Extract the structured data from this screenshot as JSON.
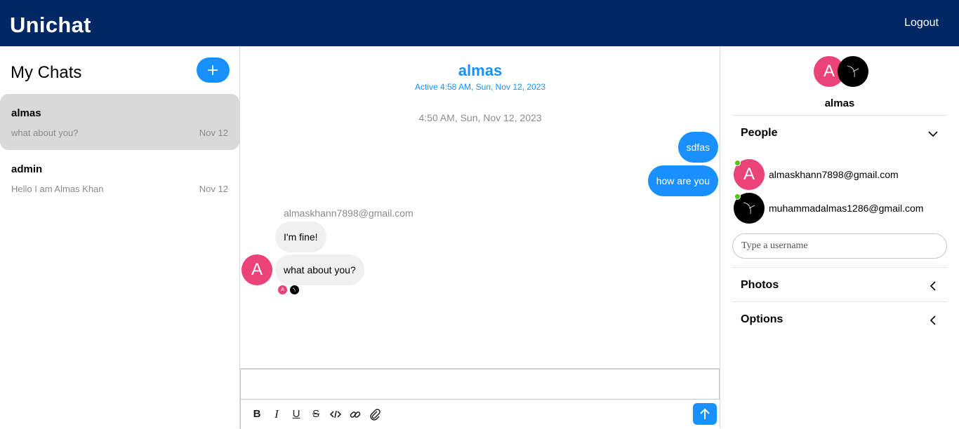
{
  "app": {
    "brand": "Unichat",
    "logout_label": "Logout"
  },
  "chat_list": {
    "title": "My Chats",
    "new_chat_icon": "plus-icon",
    "chats": [
      {
        "name": "almas",
        "preview": "what about you?",
        "date": "Nov 12",
        "active": true
      },
      {
        "name": "admin",
        "preview": "Hello I am Almas Khan",
        "date": "Nov 12",
        "active": false
      }
    ]
  },
  "feed": {
    "title": "almas",
    "subtitle": "Active 4:58 AM, Sun, Nov 12, 2023",
    "timestamp": "4:50 AM, Sun, Nov 12, 2023",
    "my_messages": [
      "sdfas",
      "how are you"
    ],
    "their_sender": "almaskhann7898@gmail.com",
    "their_messages": [
      "I'm fine!",
      "what about you?"
    ],
    "avatar_initial": "A",
    "composer_placeholder": "",
    "toolbar": [
      "bold-icon",
      "italic-icon",
      "underline-icon",
      "strikethrough-icon",
      "code-icon",
      "link-icon",
      "attachment-icon"
    ],
    "send_icon": "arrow-up-icon"
  },
  "settings": {
    "chat_title": "almas",
    "avatar_initial": "A",
    "people_title": "People",
    "people": [
      {
        "email": "almaskhann7898@gmail.com",
        "initial": "A",
        "online": true
      },
      {
        "email": "muhammadalmas1286@gmail.com",
        "initial": "",
        "online": true
      }
    ],
    "username_placeholder": "Type a username",
    "photos_title": "Photos",
    "options_title": "Options"
  },
  "colors": {
    "topbar": "#002766",
    "accent": "#1890ff",
    "avatar_pink": "#eb4379",
    "online": "#52c41a",
    "active_chat": "#d9d9d9"
  }
}
